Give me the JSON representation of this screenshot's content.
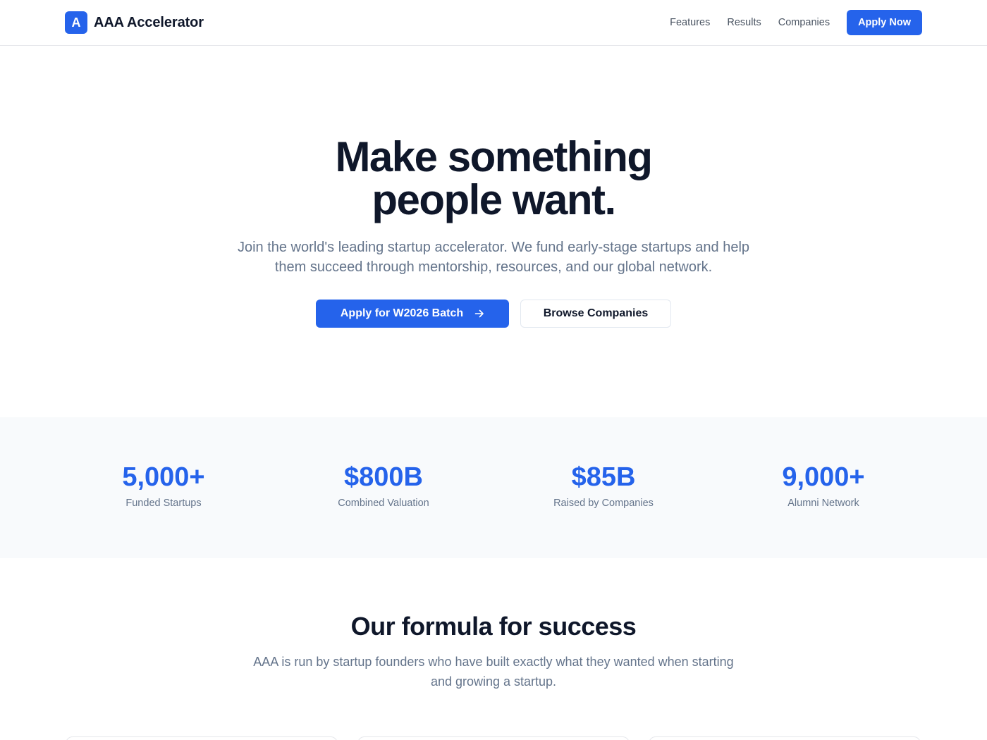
{
  "header": {
    "brand_letter": "A",
    "brand_name": "AAA Accelerator",
    "nav": [
      "Features",
      "Results",
      "Companies"
    ],
    "apply_label": "Apply Now"
  },
  "hero": {
    "title_line1": "Make something",
    "title_line2": "people want.",
    "subtitle": "Join the world's leading startup accelerator. We fund early-stage startups and help them succeed through mentorship, resources, and our global network.",
    "primary_cta": "Apply for W2026 Batch",
    "primary_cta_icon": "arrow-right-icon",
    "secondary_cta": "Browse Companies"
  },
  "stats": [
    {
      "value": "5,000+",
      "label": "Funded Startups"
    },
    {
      "value": "$800B",
      "label": "Combined Valuation"
    },
    {
      "value": "$85B",
      "label": "Raised by Companies"
    },
    {
      "value": "9,000+",
      "label": "Alumni Network"
    }
  ],
  "formula": {
    "title": "Our formula for success",
    "subtitle": "AAA is run by startup founders who have built exactly what they wanted when starting and growing a startup."
  },
  "colors": {
    "accent": "#2563eb",
    "heading": "#0f172a",
    "muted": "#64748b",
    "stats_bg": "#f8fafc"
  }
}
